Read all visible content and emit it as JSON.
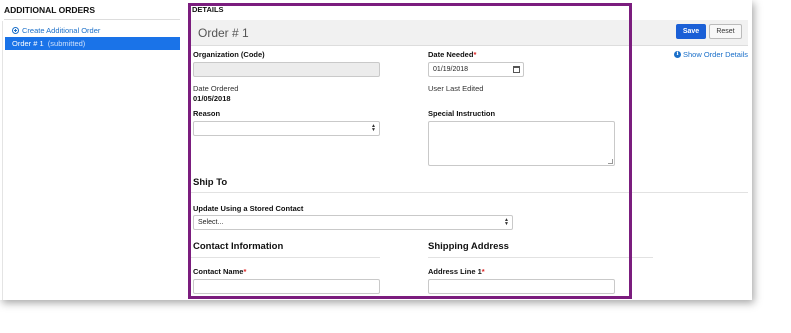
{
  "sidebar": {
    "title": "ADDITIONAL ORDERS",
    "create_link": "Create Additional Order",
    "orders": [
      {
        "label": "Order # 1",
        "status": "(submitted)"
      }
    ]
  },
  "details": {
    "title": "DETAILS",
    "order_heading": "Order # 1",
    "save_label": "Save",
    "reset_label": "Reset",
    "show_details_label": "Show Order Details",
    "organization_label": "Organization (Code)",
    "organization_value": "",
    "date_needed_label": "Date Needed",
    "date_needed_value": "01/19/2018",
    "date_ordered_label": "Date Ordered",
    "date_ordered_value": "01/05/2018",
    "user_last_edited_label": "User Last Edited",
    "reason_label": "Reason",
    "reason_value": "",
    "special_instruction_label": "Special Instruction",
    "required_mark": "*"
  },
  "ship_to": {
    "title": "Ship To",
    "stored_contact_label": "Update Using a Stored Contact",
    "stored_contact_value": "Select..."
  },
  "contact": {
    "title": "Contact Information",
    "contact_name_label": "Contact Name"
  },
  "shipping": {
    "title": "Shipping Address",
    "address_line1_label": "Address Line 1"
  },
  "colors": {
    "accent": "#1a73e8",
    "save_button": "#1a5fd6",
    "link": "#1a6fc9",
    "highlight_frame": "#7b1d7e",
    "required": "#dd2222"
  }
}
